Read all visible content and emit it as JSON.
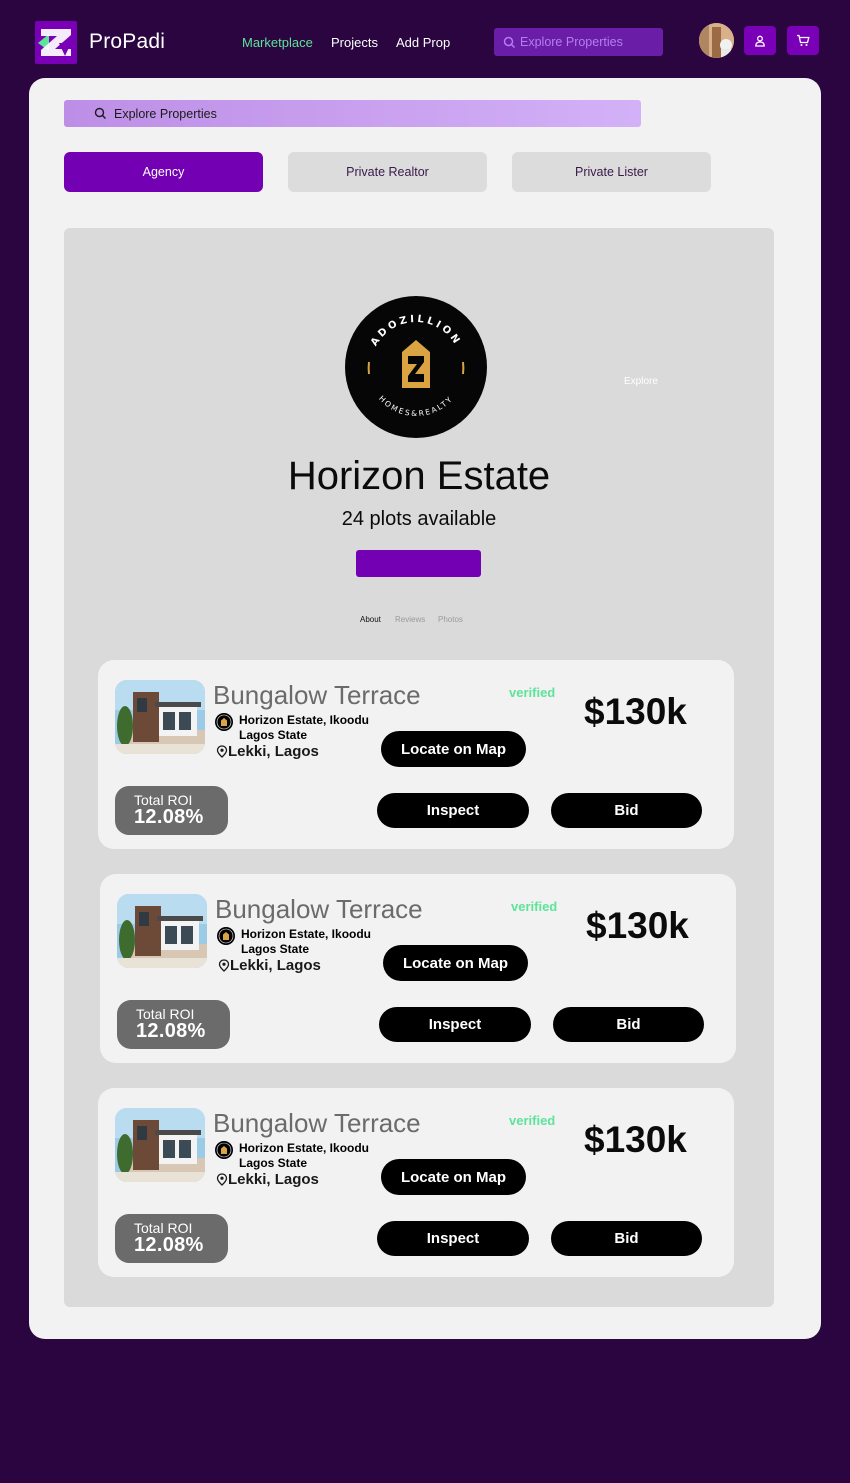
{
  "app": {
    "brand": "ProPadi"
  },
  "nav": {
    "links": [
      "Marketplace",
      "Projects",
      "Add Prop"
    ],
    "search_placeholder": "Explore Properties"
  },
  "main": {
    "search_placeholder": "Explore Properties",
    "tabs": [
      "Agency",
      "Private Realtor",
      "Private Lister"
    ]
  },
  "estate": {
    "logo_text_top": "ADOZILLION",
    "logo_text_bottom": "HOMES&REALTY",
    "explore_label": "Explore",
    "title": "Horizon Estate",
    "subtitle": "24 plots available",
    "subtabs": [
      "About",
      "Reviews",
      "Photos"
    ]
  },
  "listings": [
    {
      "title": "Bungalow Terrace",
      "agent_line1": "Horizon Estate, Ikoodu",
      "agent_line2": "Lagos State",
      "location": "Lekki, Lagos",
      "verified": "verified",
      "price": "$130k",
      "map_label": "Locate on Map",
      "roi_label": "Total ROI",
      "roi_value": "12.08%",
      "inspect_label": "Inspect",
      "bid_label": "Bid"
    },
    {
      "title": "Bungalow Terrace",
      "agent_line1": "Horizon Estate, Ikoodu",
      "agent_line2": "Lagos State",
      "location": "Lekki, Lagos",
      "verified": "verified",
      "price": "$130k",
      "map_label": "Locate on Map",
      "roi_label": "Total ROI",
      "roi_value": "12.08%",
      "inspect_label": "Inspect",
      "bid_label": "Bid"
    },
    {
      "title": "Bungalow Terrace",
      "agent_line1": "Horizon Estate, Ikoodu",
      "agent_line2": "Lagos State",
      "location": "Lekki, Lagos",
      "verified": "verified",
      "price": "$130k",
      "map_label": "Locate on Map",
      "roi_label": "Total ROI",
      "roi_value": "12.08%",
      "inspect_label": "Inspect",
      "bid_label": "Bid"
    }
  ],
  "colors": {
    "page_bg": "#2a0540",
    "accent": "#7300b3",
    "active_link": "#5ee39a",
    "verified": "#5ee39a"
  },
  "icons": [
    "propadi-logo-icon",
    "search-icon",
    "user-icon",
    "cart-icon",
    "location-pin-icon"
  ]
}
